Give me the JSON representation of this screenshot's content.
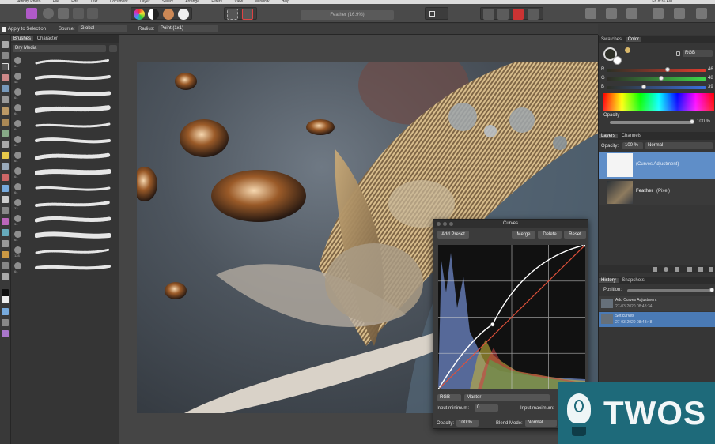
{
  "menubar": {
    "items": [
      "Affinity Photo",
      "File",
      "Edit",
      "Text",
      "Document",
      "Layer",
      "Select",
      "Arrange",
      "Filters",
      "View",
      "Window",
      "Help"
    ],
    "status": "Fri 8:36 AM"
  },
  "toolbar": {
    "document_title": "Feather (16.9%)"
  },
  "context_bar": {
    "apply_to_selection": "Apply to Selection",
    "source_label": "Source:",
    "source_value": "Global",
    "radius_label": "Radius:",
    "radius_value": "Point (1x1)"
  },
  "brushes_panel": {
    "tabs": [
      "Brushes",
      "Character"
    ],
    "category": "Dry Media",
    "brush_sizes": [
      "64",
      "48",
      "64",
      "64",
      "64",
      "64",
      "64",
      "64",
      "64",
      "32",
      "34",
      "64",
      "128",
      "64"
    ]
  },
  "color_panel": {
    "tabs": [
      "Swatches",
      "Color"
    ],
    "mode": "RGB",
    "channels": [
      {
        "name": "R",
        "value": "46"
      },
      {
        "name": "G",
        "value": "48"
      },
      {
        "name": "B",
        "value": "39"
      }
    ],
    "opacity_label": "Opacity",
    "opacity_value": "100 %"
  },
  "layers_panel": {
    "tabs": [
      "Layers",
      "Channels"
    ],
    "opacity_label": "Opacity:",
    "opacity_value": "100 %",
    "blend_mode": "Normal",
    "layers": [
      {
        "name": "(Curves Adjustment)"
      },
      {
        "name": "Feather",
        "type": "(Pixel)"
      }
    ]
  },
  "history_panel": {
    "tabs": [
      "History",
      "Snapshots"
    ],
    "position_label": "Position:",
    "entries": [
      {
        "action": "Add Curves Adjustment",
        "time": "27-03-2020 08:48:34"
      },
      {
        "action": "Set curves",
        "time": "27-03-2020 08:48:48"
      }
    ]
  },
  "curves_dialog": {
    "title": "Curves",
    "add_preset": "Add Preset",
    "merge": "Merge",
    "delete": "Delete",
    "reset": "Reset",
    "channel": "RGB",
    "mode": "Master",
    "input_minimum_label": "Input minimum:",
    "input_minimum_value": "0",
    "input_maximum_label": "Input maximum:",
    "opacity_label": "Opacity:",
    "opacity_value": "100 %",
    "blend_mode_label": "Blend Mode:",
    "blend_mode_value": "Normal",
    "curve_points": [
      [
        0,
        0
      ],
      [
        0.37,
        0.45
      ],
      [
        1,
        1
      ]
    ]
  },
  "watermark": {
    "text": "TWOS"
  },
  "colors": {
    "accent": "#2d7fd6",
    "selection_row": "#4a7ab5",
    "watermark_bg": "#1e6a7a"
  }
}
